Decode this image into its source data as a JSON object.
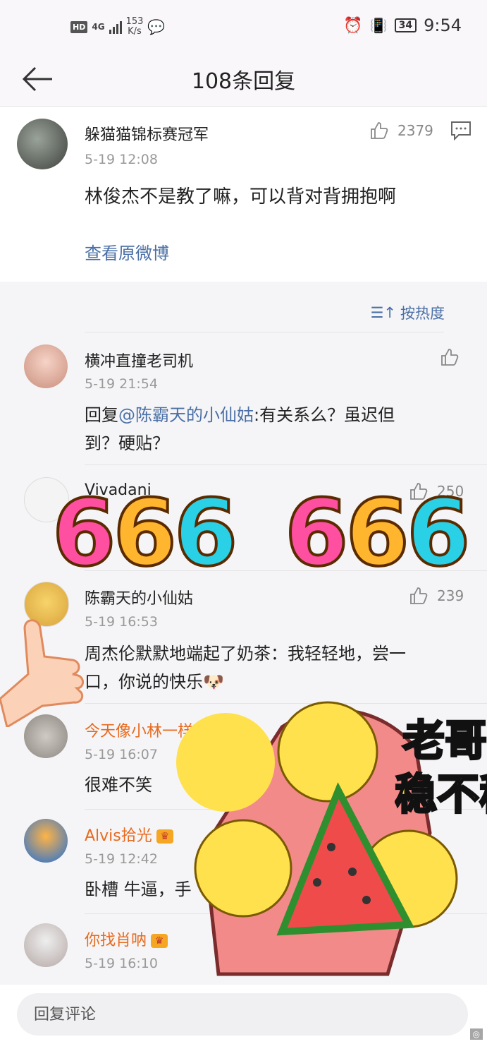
{
  "status_bar": {
    "network_badge": "HD",
    "network_type": "4G",
    "net_speed_value": "153",
    "net_speed_unit": "K/s",
    "battery": "34",
    "time": "9:54"
  },
  "header": {
    "title": "108条回复"
  },
  "original_comment": {
    "username": "躲猫猫锦标赛冠军",
    "time": "5-19 12:08",
    "likes": "2379",
    "text": "林俊杰不是教了嘛，可以背对背拥抱啊",
    "view_original": "查看原微博"
  },
  "sort_label": "按热度",
  "replies": [
    {
      "username": "横冲直撞老司机",
      "time": "5-19 21:54",
      "likes": "",
      "reply_prefix": "回复",
      "mention": "@陈霸天的小仙姑",
      "text_line1": ":有关系么？虽迟但",
      "text_line2": "到？硬贴？"
    },
    {
      "username": "Vivadani",
      "likes": "250"
    },
    {
      "username": "陈霸天的小仙姑",
      "time": "5-19 16:53",
      "likes": "239",
      "text_line1": "周杰伦默默地端起了奶茶：我轻轻地，尝一",
      "text_line2": "口，你说的快乐"
    },
    {
      "username": "今天像小林一样努",
      "time": "5-19 16:07",
      "text": "很难不笑"
    },
    {
      "username": "Alvis拾光",
      "time": "5-19 12:42",
      "text": "卧槽 牛逼，手"
    },
    {
      "username": "你找肖呐",
      "time": "5-19 16:10"
    }
  ],
  "sticker_texts": {
    "six_left": "666",
    "six_right": "666",
    "laoge_line1": "老哥",
    "laoge_line2": "稳不稳"
  },
  "footer": {
    "input_placeholder": "回复评论"
  },
  "colors": {
    "link": "#4a6fa5",
    "vip_name": "#e86a1e",
    "background": "#f5f5f7"
  }
}
